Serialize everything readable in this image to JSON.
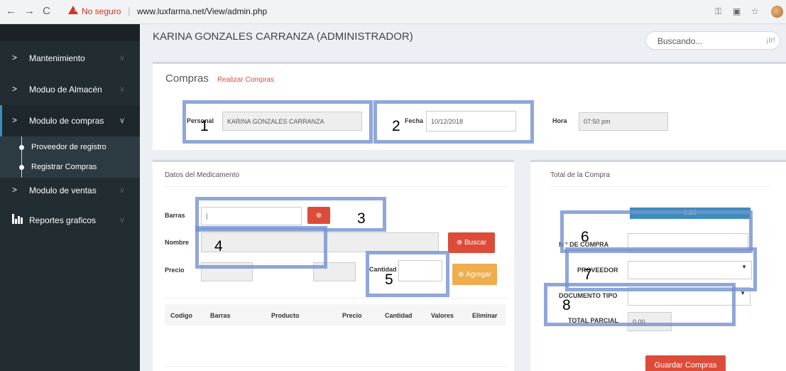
{
  "browser": {
    "insecure": "No seguro",
    "separator": "|",
    "url": "www.luxfarma.net/View/admin.php"
  },
  "sidebar": {
    "items": [
      {
        "label": "Mantenimiento"
      },
      {
        "label": "Moduo de Almacén"
      },
      {
        "label": "Modulo de compras"
      },
      {
        "label": "Modulo de ventas"
      },
      {
        "label": "Reportes graficos"
      }
    ],
    "subitems": [
      {
        "label": "Proveedor de registro"
      },
      {
        "label": "Registrar Compras"
      }
    ]
  },
  "header": {
    "title": "KARINA GONZALES CARRANZA (ADMINISTRADOR)",
    "search_placeholder": "Buscando...",
    "search_button": "¡Ir!"
  },
  "compras": {
    "title": "Compras",
    "subtitle": "Realizar Compras",
    "personal_label": "Personal",
    "personal_value": "KARINA GONZALES CARRANZA",
    "fecha_label": "Fecha",
    "fecha_value": "10/12/2018",
    "hora_label": "Hora",
    "hora_value": "07:50 pm"
  },
  "medicamento": {
    "title": "Datos del Medicamento",
    "barras_label": "Barras",
    "nombre_label": "Nombre",
    "precio_label": "Precio",
    "cantidad_label": "Cantidad",
    "buscar_button": "Buscar",
    "agregar_button": "Agregar",
    "columns": [
      "Codigo",
      "Barras",
      "Producto",
      "Precio",
      "Cantidad",
      "Valores",
      "Eliminar"
    ]
  },
  "total": {
    "title": "Total de la Compra",
    "total_value": "0.00",
    "n_compra_label": "N ° DE COMPRA",
    "proveedor_label": "PROVEEDOR",
    "documento_label": "DOCUMENTO TIPO",
    "total_parcial_label": "TOTAL PARCIAL",
    "total_parcial_value": "0.00",
    "guardar_button": "Guardar Compras"
  },
  "annotations": [
    "1",
    "2",
    "3",
    "4",
    "5",
    "6",
    "7",
    "8"
  ],
  "colors": {
    "sidebar_bg": "#222d32",
    "accent_blue": "#3c8dbc",
    "danger": "#dd4b39",
    "warning": "#f0ad4e",
    "annotation": "#7491d0"
  }
}
